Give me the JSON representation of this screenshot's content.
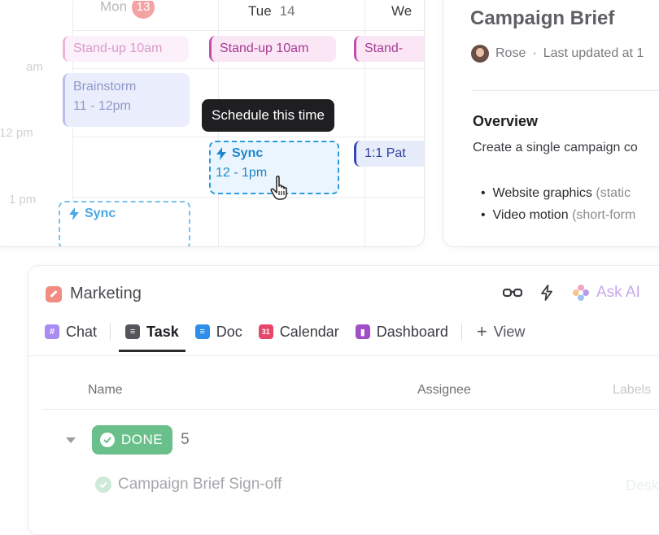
{
  "calendar": {
    "days": [
      {
        "name": "Mon",
        "num": "13"
      },
      {
        "name": "Tue",
        "num": "14"
      },
      {
        "name": "We"
      }
    ],
    "times": [
      "am",
      "12 pm",
      "1 pm"
    ],
    "events": {
      "mon_standup": "Stand-up 10am",
      "tue_standup": "Stand-up 10am",
      "wed_standup": "Stand-",
      "brainstorm_title": "Brainstorm",
      "brainstorm_time": "11 - 12pm",
      "sync_title": "Sync",
      "sync_time": "12 - 1pm",
      "wed_pat": "1:1 Pat",
      "mon_sync": "Sync"
    },
    "tooltip": "Schedule this time"
  },
  "doc": {
    "title": "Campaign Brief",
    "author": "Rose",
    "separator": "·",
    "updated": "Last updated at 1",
    "heading": "Overview",
    "paragraph": "Create a single campaign co",
    "bullets": [
      {
        "text": "Website graphics",
        "faded": "(static"
      },
      {
        "text": "Video motion",
        "faded": "(short-form"
      }
    ]
  },
  "marketing": {
    "title": "Marketing",
    "ask_ai": "Ask AI",
    "tabs": {
      "chat": "Chat",
      "task": "Task",
      "doc": "Doc",
      "calendar": "Calendar",
      "calendar_badge": "31",
      "dashboard": "Dashboard",
      "view": "View"
    },
    "columns": {
      "name": "Name",
      "assignee": "Assignee",
      "labels": "Labels"
    },
    "group": {
      "status": "DONE",
      "count": "5"
    },
    "task": "Campaign Brief Sign-off",
    "task_label": "Desk"
  },
  "colors": {
    "accent_pink": "#c44cab",
    "accent_blue": "#2b9be0",
    "done_green": "#6ac08a",
    "today_badge": "#f4a3a3"
  }
}
